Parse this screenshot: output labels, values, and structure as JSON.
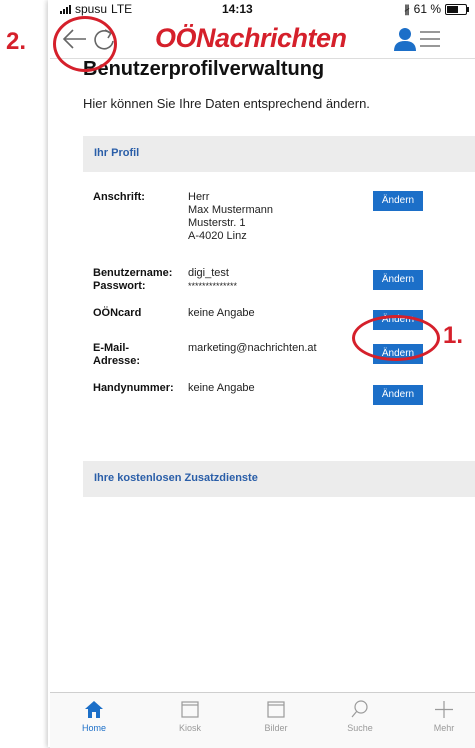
{
  "status_bar": {
    "carrier": "spusu",
    "network": "LTE",
    "time": "14:13",
    "battery": "61 %",
    "battery_level": 0.61
  },
  "header": {
    "logo": "OÖNachrichten"
  },
  "page": {
    "title": "Benutzerprofilverwaltung",
    "subtitle": "Hier können Sie Ihre Daten entsprechend ändern."
  },
  "profile": {
    "section_title": "Ihr Profil",
    "button_label": "Ändern",
    "address": {
      "label": "Anschrift:",
      "lines": [
        "Herr",
        "Max Mustermann",
        "Musterstr. 1",
        "A-4020 Linz"
      ]
    },
    "credentials": {
      "label_user": "Benutzername:",
      "label_pass": "Passwort:",
      "username": "digi_test",
      "password": "**************"
    },
    "card": {
      "label": "OÖNcard",
      "value": "keine Angabe"
    },
    "email": {
      "label": "E-Mail-Adresse:",
      "value": "marketing@nachrichten.at"
    },
    "phone": {
      "label": "Handynummer:",
      "value": "keine Angabe"
    }
  },
  "services": {
    "section_title": "Ihre kostenlosen Zusatzdienste"
  },
  "annotations": {
    "one": "1.",
    "two": "2."
  },
  "tabs": [
    {
      "label": "Home",
      "icon": "home-icon",
      "active": true
    },
    {
      "label": "Kiosk",
      "icon": "kiosk-icon",
      "active": false
    },
    {
      "label": "Bilder",
      "icon": "pictures-icon",
      "active": false
    },
    {
      "label": "Suche",
      "icon": "search-icon",
      "active": false
    },
    {
      "label": "Mehr",
      "icon": "plus-icon",
      "active": false
    }
  ],
  "colors": {
    "accent": "#1c6fc8",
    "brand": "#d5202b",
    "section_bg": "#ececec"
  }
}
